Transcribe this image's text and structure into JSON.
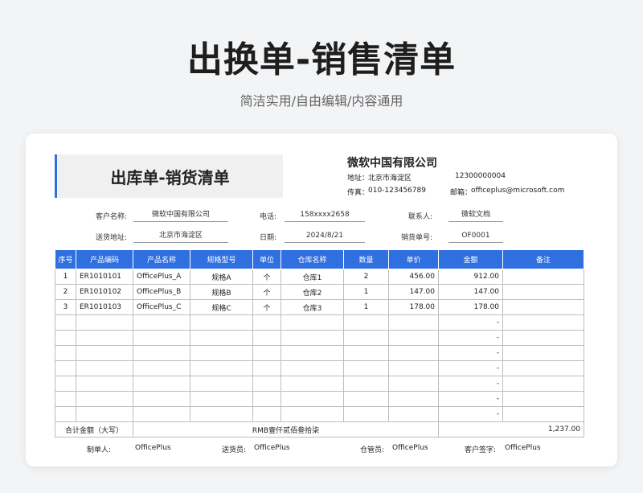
{
  "hero": {
    "title": "出换单-销售清单",
    "subtitle": "简洁实用/自由编辑/内容通用"
  },
  "doc": {
    "title": "出库单-销货清单",
    "company_name": "微软中国有限公司",
    "address_label": "地址：",
    "address": "北京市海淀区",
    "phone_number": "12300000004",
    "fax_label": "传真：",
    "fax": "010-123456789",
    "email_label": "邮箱：",
    "email": "officeplus@microsoft.com"
  },
  "form": {
    "customer_label": "客户名称:",
    "customer": "微软中国有限公司",
    "tel_label": "电话:",
    "tel": "158xxxx2658",
    "contact_label": "联系人:",
    "contact": "微软文档",
    "delivery_address_label": "送货地址:",
    "delivery_address": "北京市海淀区",
    "date_label": "日期:",
    "date": "2024/8/21",
    "order_no_label": "销货单号:",
    "order_no": "OF0001"
  },
  "table": {
    "headers": [
      "序号",
      "产品编码",
      "产品名称",
      "规格型号",
      "单位",
      "仓库名称",
      "数量",
      "单价",
      "金额",
      "备注"
    ],
    "rows": [
      [
        "1",
        "ER1010101",
        "OfficePlus_A",
        "规格A",
        "个",
        "仓库1",
        "2",
        "456.00",
        "912.00",
        ""
      ],
      [
        "2",
        "ER1010102",
        "OfficePlus_B",
        "规格B",
        "个",
        "仓库2",
        "1",
        "147.00",
        "147.00",
        ""
      ],
      [
        "3",
        "ER1010103",
        "OfficePlus_C",
        "规格C",
        "个",
        "仓库3",
        "1",
        "178.00",
        "178.00",
        ""
      ],
      [
        "",
        "",
        "",
        "",
        "",
        "",
        "",
        "",
        "-",
        ""
      ],
      [
        "",
        "",
        "",
        "",
        "",
        "",
        "",
        "",
        "-",
        ""
      ],
      [
        "",
        "",
        "",
        "",
        "",
        "",
        "",
        "",
        "-",
        ""
      ],
      [
        "",
        "",
        "",
        "",
        "",
        "",
        "",
        "",
        "-",
        ""
      ],
      [
        "",
        "",
        "",
        "",
        "",
        "",
        "",
        "",
        "-",
        ""
      ],
      [
        "",
        "",
        "",
        "",
        "",
        "",
        "",
        "",
        "-",
        ""
      ],
      [
        "",
        "",
        "",
        "",
        "",
        "",
        "",
        "",
        "-",
        ""
      ]
    ],
    "total_label": "合计金额（大写）",
    "total_words": "RMB壹仟贰佰叁拾柒",
    "total_amount": "1,237.00"
  },
  "signatures": {
    "maker_label": "制单人:",
    "maker": "OfficePlus",
    "deliverer_label": "送货员:",
    "deliverer": "OfficePlus",
    "keeper_label": "仓管员:",
    "keeper": "OfficePlus",
    "customer_sign_label": "客户签字:",
    "customer_sign": "OfficePlus"
  },
  "colors": {
    "accent": "#2f6fe0"
  }
}
